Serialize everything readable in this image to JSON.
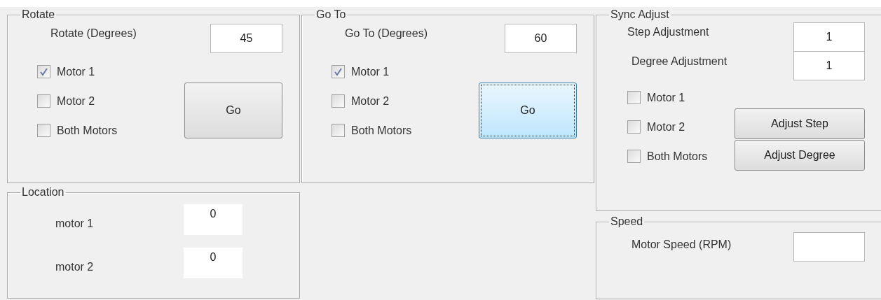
{
  "columns": [
    [
      {
        "kind": "command",
        "title": "Rotate",
        "label": "Rotate (Degrees)",
        "value": "45",
        "checkboxes": [
          {
            "label": "Motor 1",
            "checked": true
          },
          {
            "label": "Motor 2",
            "checked": false
          },
          {
            "label": "Both Motors",
            "checked": false
          }
        ],
        "button": {
          "label": "Go",
          "focused": false
        }
      },
      {
        "kind": "location",
        "title": "Location",
        "readouts": [
          {
            "label": "motor 1",
            "value": "0"
          },
          {
            "label": "motor 2",
            "value": "0"
          }
        ]
      }
    ],
    [
      {
        "kind": "command",
        "title": "Go To",
        "label": "Go To (Degrees)",
        "value": "60",
        "checkboxes": [
          {
            "label": "Motor 1",
            "checked": true
          },
          {
            "label": "Motor 2",
            "checked": false
          },
          {
            "label": "Both Motors",
            "checked": false
          }
        ],
        "button": {
          "label": "Go",
          "focused": true
        }
      }
    ],
    [
      {
        "kind": "sync",
        "title": "Sync Adjust",
        "fields": [
          {
            "label": "Step Adjustment",
            "value": "1"
          },
          {
            "label": "Degree Adjustment",
            "value": "1"
          }
        ],
        "checkboxes": [
          {
            "label": "Motor 1",
            "checked": false
          },
          {
            "label": "Motor 2",
            "checked": false
          },
          {
            "label": "Both Motors",
            "checked": false
          }
        ],
        "buttons": [
          "Adjust Step",
          "Adjust Degree"
        ]
      },
      {
        "kind": "speed",
        "title": "Speed",
        "label": "Motor Speed (RPM)"
      }
    ]
  ]
}
